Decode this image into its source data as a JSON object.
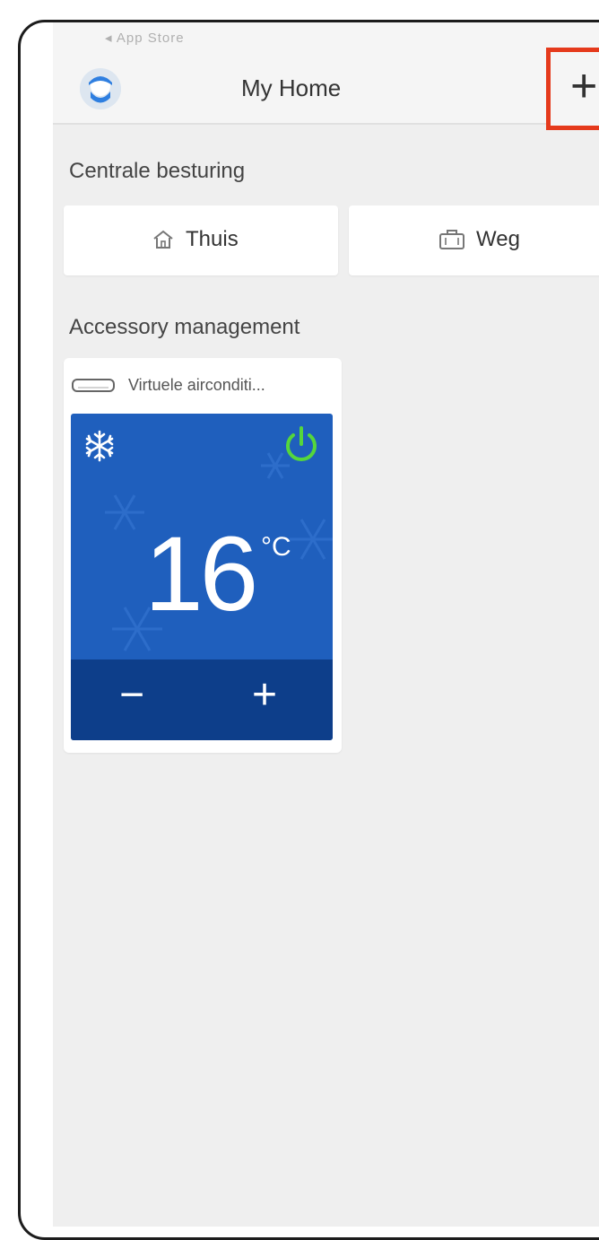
{
  "status_bar": {
    "label": "◂ App Store"
  },
  "header": {
    "title": "My Home",
    "add_glyph": "+",
    "highlight_color": "#e53a1c"
  },
  "central_control": {
    "label": "Centrale besturing",
    "modes": [
      {
        "label": "Thuis",
        "icon": "home-icon"
      },
      {
        "label": "Weg",
        "icon": "suitcase-icon"
      }
    ]
  },
  "accessories": {
    "label": "Accessory management",
    "devices": [
      {
        "name": "Virtuele airconditi...",
        "icon": "air-conditioner-icon",
        "mode_icon": "snowflake-icon",
        "power_icon": "power-icon",
        "temperature": "16",
        "unit": "°C",
        "decrease": "−",
        "increase": "+",
        "panel_color": "#1f5fbd",
        "controls_color": "#0d3e8a",
        "power_color": "#55d63c"
      }
    ]
  }
}
